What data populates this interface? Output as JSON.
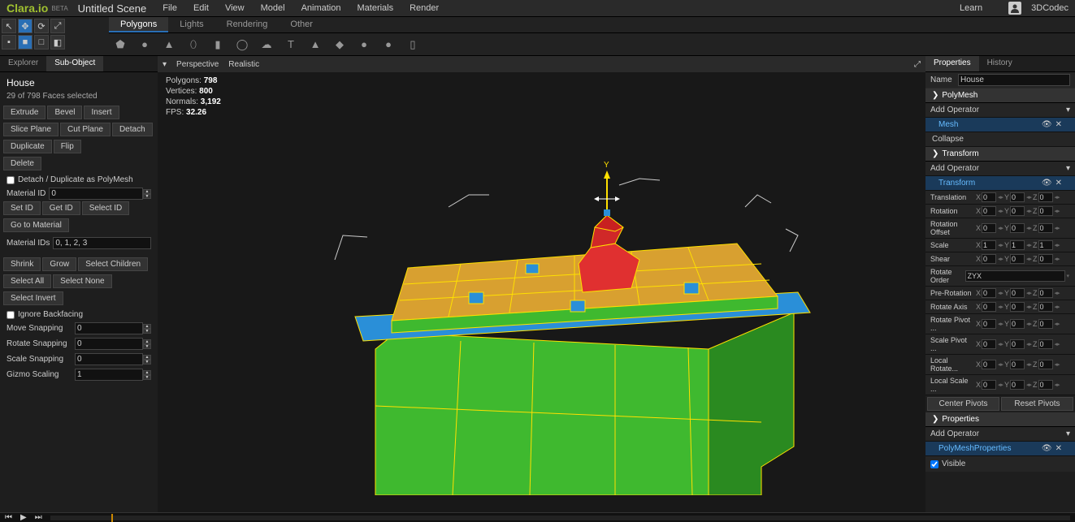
{
  "app": {
    "logo": "Clara.io",
    "beta": "BETA",
    "scene_title": "Untitled Scene"
  },
  "menu": [
    "File",
    "Edit",
    "View",
    "Model",
    "Animation",
    "Materials",
    "Render"
  ],
  "topright": {
    "learn": "Learn",
    "user": "3DCodec"
  },
  "maintabs": [
    "Polygons",
    "Lights",
    "Rendering",
    "Other"
  ],
  "lefttabs": [
    "Explorer",
    "Sub-Object"
  ],
  "subobject": {
    "name": "House",
    "sel_info": "29 of 798 Faces selected",
    "ops1": [
      "Extrude",
      "Bevel",
      "Insert"
    ],
    "ops2": [
      "Slice Plane",
      "Cut Plane",
      "Detach"
    ],
    "ops3": [
      "Duplicate",
      "Flip"
    ],
    "delete": "Delete",
    "detach_cb": "Detach / Duplicate as PolyMesh",
    "material_id_label": "Material ID",
    "material_id": "0",
    "idops": [
      "Set ID",
      "Get ID",
      "Select ID"
    ],
    "goto_mat": "Go to Material",
    "material_ids_label": "Material IDs",
    "material_ids": "0, 1, 2, 3",
    "sel_ops1": [
      "Shrink",
      "Grow",
      "Select Children"
    ],
    "sel_ops2": [
      "Select All",
      "Select None"
    ],
    "sel_ops3": [
      "Select Invert"
    ],
    "ignore_back": "Ignore Backfacing",
    "snap": [
      {
        "label": "Move Snapping",
        "val": "0"
      },
      {
        "label": "Rotate Snapping",
        "val": "0"
      },
      {
        "label": "Scale Snapping",
        "val": "0"
      },
      {
        "label": "Gizmo Scaling",
        "val": "1"
      }
    ]
  },
  "viewport": {
    "mode1": "Perspective",
    "mode2": "Realistic",
    "stats": {
      "polygons_label": "Polygons:",
      "polygons": "798",
      "vertices_label": "Vertices:",
      "vertices": "800",
      "normals_label": "Normals:",
      "normals": "3,192",
      "fps_label": "FPS:",
      "fps": "32.26"
    }
  },
  "righttabs": [
    "Properties",
    "History"
  ],
  "props": {
    "name_label": "Name",
    "name": "House",
    "sec_polymesh": "PolyMesh",
    "add_operator": "Add Operator",
    "mesh_item": "Mesh",
    "collapse": "Collapse",
    "sec_transform": "Transform",
    "transform_item": "Transform",
    "rotate_order_label": "Rotate Order",
    "rotate_order": "ZYX",
    "xyz": [
      {
        "label": "Translation",
        "x": "0",
        "y": "0",
        "z": "0"
      },
      {
        "label": "Rotation",
        "x": "0",
        "y": "0",
        "z": "0"
      },
      {
        "label": "Rotation Offset",
        "x": "0",
        "y": "0",
        "z": "0"
      },
      {
        "label": "Scale",
        "x": "1",
        "y": "1",
        "z": "1"
      },
      {
        "label": "Shear",
        "x": "0",
        "y": "0",
        "z": "0"
      }
    ],
    "xyz2": [
      {
        "label": "Pre-Rotation",
        "x": "0",
        "y": "0",
        "z": "0"
      },
      {
        "label": "Rotate Axis",
        "x": "0",
        "y": "0",
        "z": "0"
      },
      {
        "label": "Rotate Pivot ...",
        "x": "0",
        "y": "0",
        "z": "0"
      },
      {
        "label": "Scale Pivot ...",
        "x": "0",
        "y": "0",
        "z": "0"
      },
      {
        "label": "Local Rotate...",
        "x": "0",
        "y": "0",
        "z": "0"
      },
      {
        "label": "Local Scale ...",
        "x": "0",
        "y": "0",
        "z": "0"
      }
    ],
    "center_pivots": "Center Pivots",
    "reset_pivots": "Reset Pivots",
    "sec_properties": "Properties",
    "polymesh_props": "PolyMeshProperties",
    "visible": "Visible"
  }
}
